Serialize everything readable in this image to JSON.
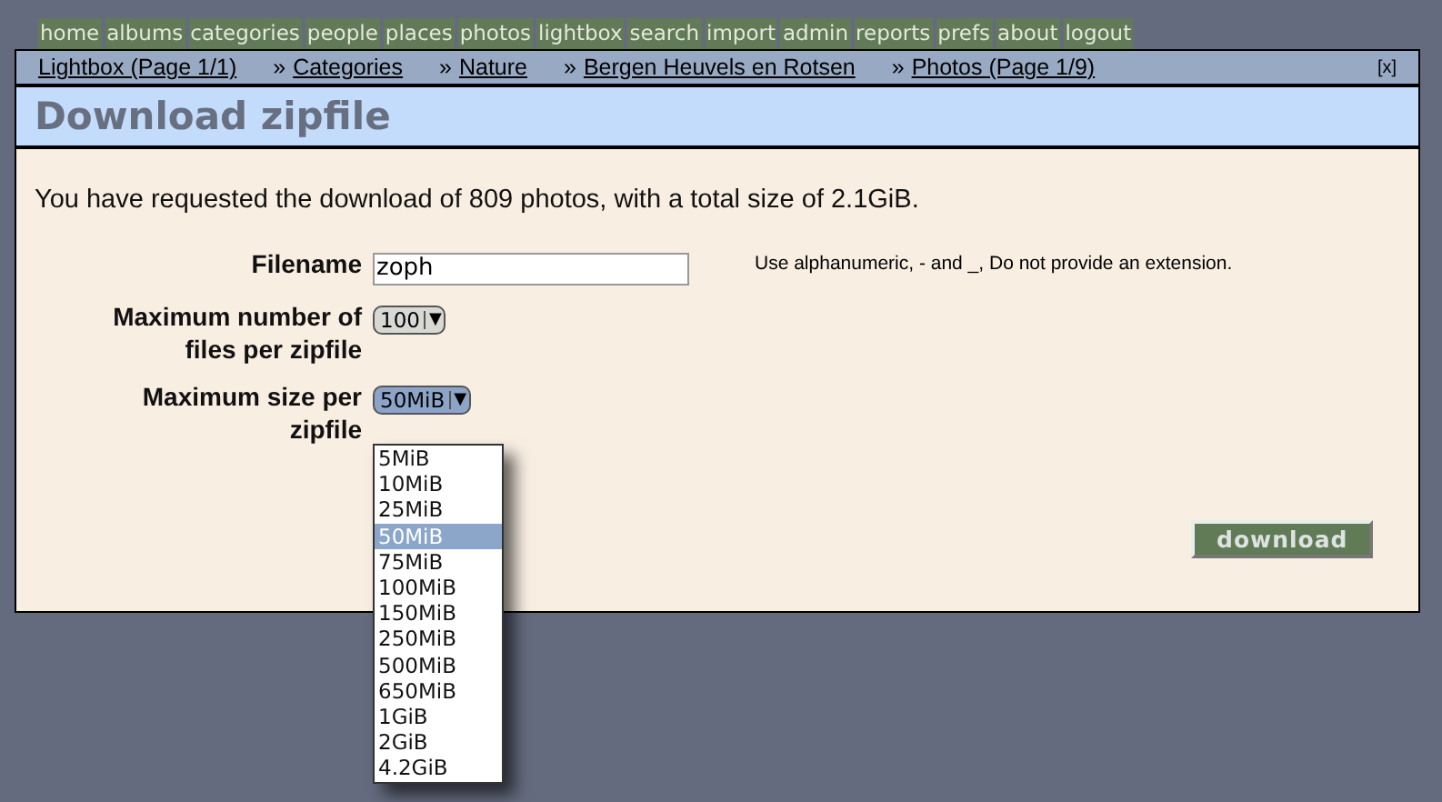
{
  "menu": [
    {
      "label": "home"
    },
    {
      "label": "albums"
    },
    {
      "label": "categories"
    },
    {
      "label": "people"
    },
    {
      "label": "places"
    },
    {
      "label": "photos"
    },
    {
      "label": "lightbox"
    },
    {
      "label": "search"
    },
    {
      "label": "import"
    },
    {
      "label": "admin"
    },
    {
      "label": "reports"
    },
    {
      "label": "prefs"
    },
    {
      "label": "about"
    },
    {
      "label": "logout"
    }
  ],
  "breadcrumbs": [
    {
      "label": "Lightbox (Page 1/1)"
    },
    {
      "label": "Categories",
      "separator": "»"
    },
    {
      "label": "Nature",
      "separator": "»"
    },
    {
      "label": "Bergen Heuvels en Rotsen",
      "separator": "»"
    },
    {
      "label": "Photos (Page 1/9)",
      "separator": "»"
    }
  ],
  "close_link": "[x]",
  "title": "Download zipfile",
  "message": "You have requested the download of 809 photos, with a total size of 2.1GiB.",
  "form": {
    "filename": {
      "label": "Filename",
      "value": "zoph",
      "hint": "Use alphanumeric, - and _, Do not provide an extension."
    },
    "max_files": {
      "label": "Maximum number of files per zipfile",
      "value": "100",
      "arrow": "▼"
    },
    "max_size": {
      "label": "Maximum size per zipfile",
      "value": "50MiB",
      "arrow": "▼",
      "expanded": true,
      "options": [
        {
          "label": "5MiB",
          "selected": false
        },
        {
          "label": "10MiB",
          "selected": false
        },
        {
          "label": "25MiB",
          "selected": false
        },
        {
          "label": "50MiB",
          "selected": true
        },
        {
          "label": "75MiB",
          "selected": false
        },
        {
          "label": "100MiB",
          "selected": false
        },
        {
          "label": "150MiB",
          "selected": false
        },
        {
          "label": "250MiB",
          "selected": false
        },
        {
          "label": "500MiB",
          "selected": false
        },
        {
          "label": "650MiB",
          "selected": false
        },
        {
          "label": "1GiB",
          "selected": false
        },
        {
          "label": "2GiB",
          "selected": false
        },
        {
          "label": "4.2GiB",
          "selected": false
        }
      ]
    }
  },
  "button": "download"
}
